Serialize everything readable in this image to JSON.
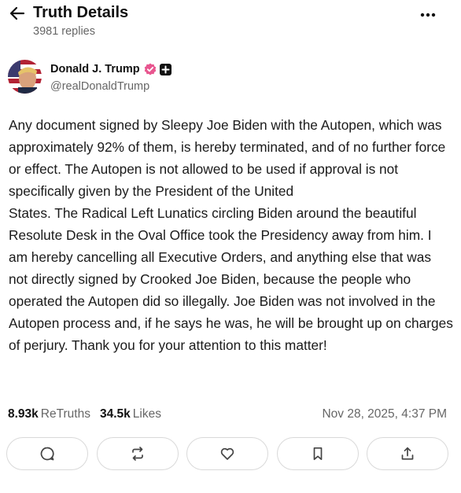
{
  "header": {
    "title": "Truth Details",
    "replies": "3981 replies",
    "back_icon": "arrow-left-icon",
    "more_icon": "more-horizontal-icon"
  },
  "author": {
    "name": "Donald J. Trump",
    "handle": "@realDonaldTrump",
    "verified_icon": "verified-badge-icon",
    "plus_icon": "plus-badge-icon",
    "verified_color": "#e8568f"
  },
  "post": {
    "line1": "Any document signed by Sleepy Joe Biden with the Autopen, which was approximately 92% of them, is hereby terminated, and of no further force or effect. The Autopen is not allowed to be used if approval is not specifically given by the President of the United",
    "line2": "States. The Radical Left Lunatics circling Biden around the beautiful Resolute Desk in the Oval Office took the Presidency away from him. I am hereby cancelling all Executive Orders, and anything else that was not directly signed by Crooked Joe Biden, because the people who operated the Autopen did so illegally. Joe Biden was not involved in the Autopen process and, if he says he was, he will be brought up on charges of perjury. Thank you for your attention to this matter!"
  },
  "stats": {
    "retruths_count": "8.93k",
    "retruths_label": "ReTruths",
    "likes_count": "34.5k",
    "likes_label": "Likes",
    "timestamp": "Nov 28, 2025, 4:37 PM"
  },
  "actions": [
    {
      "icon": "reply-icon"
    },
    {
      "icon": "retruth-icon"
    },
    {
      "icon": "like-icon"
    },
    {
      "icon": "bookmark-icon"
    },
    {
      "icon": "share-icon"
    }
  ]
}
